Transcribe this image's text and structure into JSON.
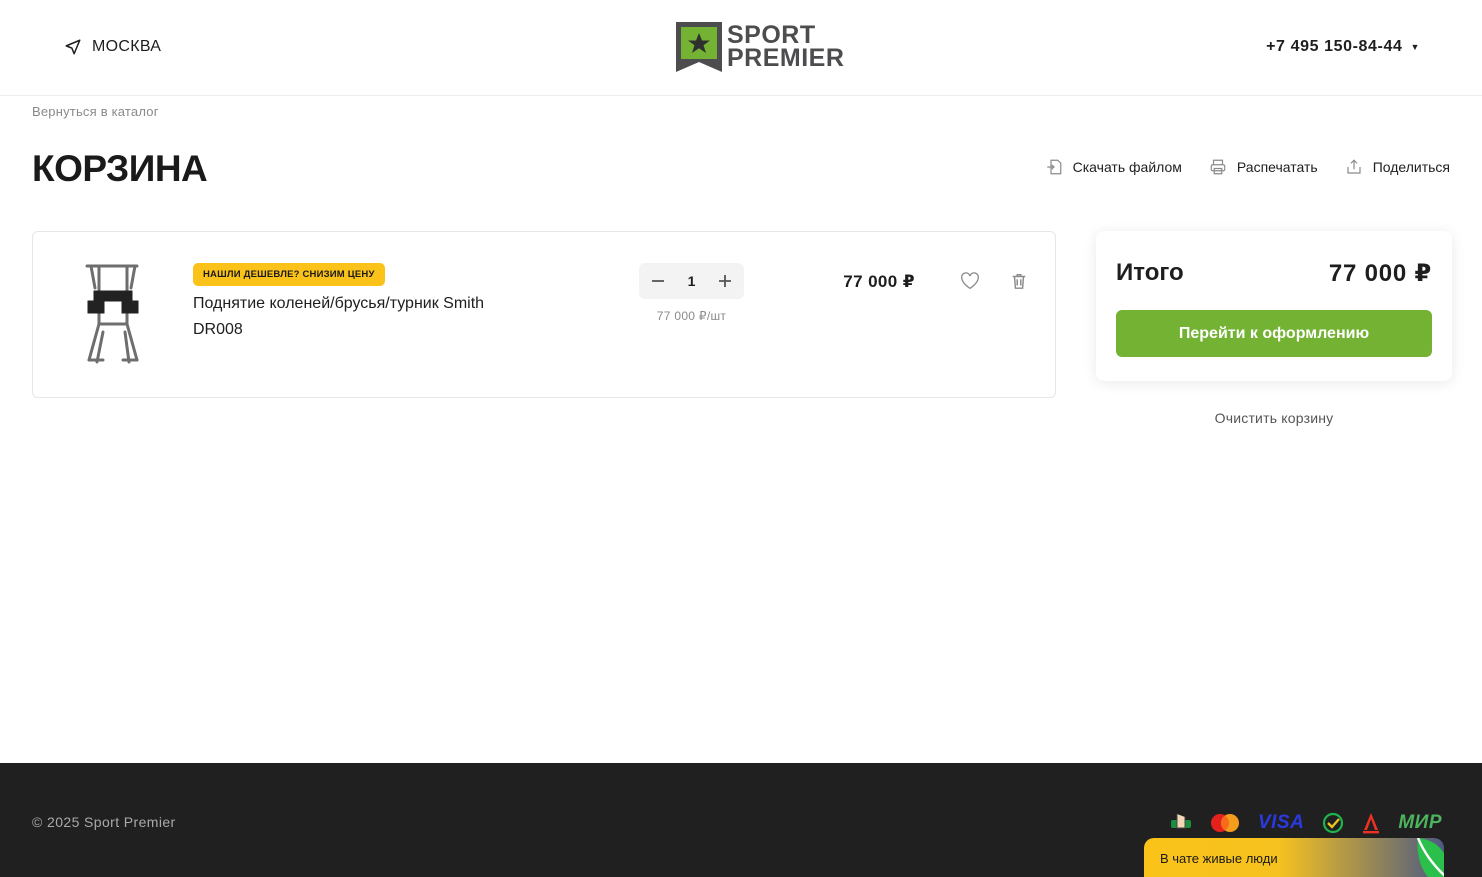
{
  "header": {
    "city": "МОСКВА",
    "logo_line1": "SPORT",
    "logo_line2": "PREMIER",
    "phone": "+7 495 150-84-44"
  },
  "breadcrumb": "Вернуться в каталог",
  "page_title": "КОРЗИНА",
  "actions": {
    "download": "Скачать файлом",
    "print": "Распечатать",
    "share": "Поделиться"
  },
  "cart": {
    "items": [
      {
        "badge": "НАШЛИ ДЕШЕВЛЕ? СНИЗИМ ЦЕНУ",
        "name": "Поднятие коленей/брусья/турник Smith DR008",
        "quantity": "1",
        "unit_price": "77 000 ₽/шт",
        "price": "77 000 ₽"
      }
    ]
  },
  "summary": {
    "label": "Итого",
    "total": "77 000 ₽",
    "checkout": "Перейти к оформлению"
  },
  "clear_cart": "Очистить корзину",
  "footer": {
    "copyright": "© 2025 Sport Premier",
    "payments": [
      "pay-hand-icon",
      "mastercard-icon",
      "visa-icon",
      "sbp-check-icon",
      "alfa-icon",
      "mir-icon"
    ],
    "visa_text": "VISA",
    "mir_text": "МИР"
  },
  "chat": {
    "text": "В чате живые люди"
  },
  "colors": {
    "accent_green": "#74b233",
    "badge_yellow": "#fbc31a",
    "footer_bg": "#202020"
  }
}
